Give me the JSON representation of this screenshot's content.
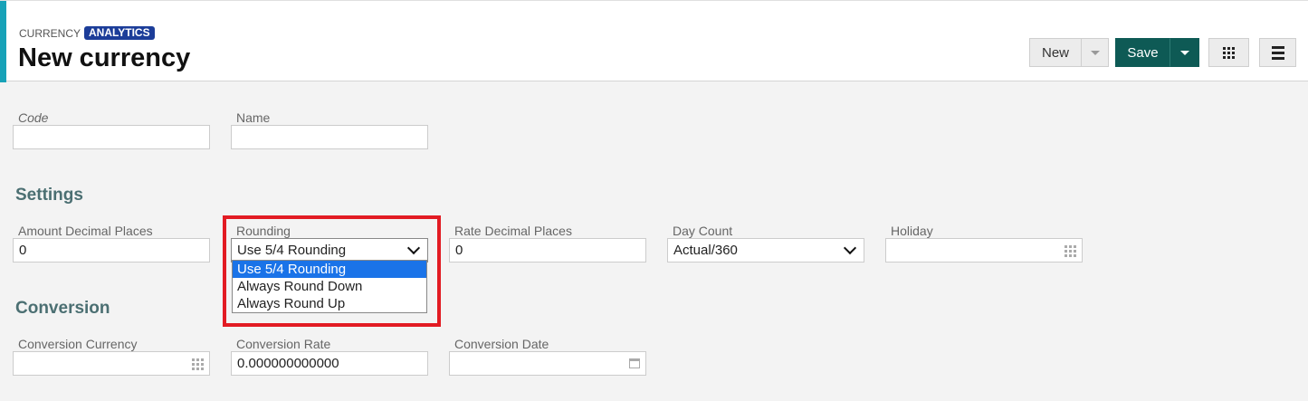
{
  "header": {
    "breadcrumb": "CURRENCY",
    "badge": "ANALYTICS",
    "title": "New currency"
  },
  "toolbar": {
    "new_label": "New",
    "save_label": "Save"
  },
  "form": {
    "code": {
      "label": "Code",
      "value": ""
    },
    "name": {
      "label": "Name",
      "value": ""
    }
  },
  "settings": {
    "title": "Settings",
    "amount_decimal_places": {
      "label": "Amount Decimal Places",
      "value": "0"
    },
    "rounding": {
      "label": "Rounding",
      "value": "Use 5/4 Rounding",
      "options": [
        "Use 5/4 Rounding",
        "Always Round Down",
        "Always Round Up"
      ]
    },
    "rate_decimal_places": {
      "label": "Rate Decimal Places",
      "value": "0"
    },
    "day_count": {
      "label": "Day Count",
      "value": "Actual/360"
    },
    "holiday": {
      "label": "Holiday",
      "value": ""
    }
  },
  "conversion": {
    "title": "Conversion",
    "currency": {
      "label": "Conversion Currency",
      "value": ""
    },
    "rate": {
      "label": "Conversion Rate",
      "value": "0.000000000000"
    },
    "date": {
      "label": "Conversion Date",
      "value": ""
    }
  },
  "colors": {
    "accent": "#17a2b8",
    "badge": "#1c3d99",
    "save_button": "#0e5a55",
    "section_title": "#4b6f72",
    "highlight": "#e21b23",
    "selected_option": "#1a73e8"
  },
  "icons": {
    "grid": "grid-icon",
    "menu": "hamburger-menu-icon",
    "calendar": "calendar-icon",
    "chevron": "chevron-down-icon",
    "caret": "caret-down-icon"
  }
}
